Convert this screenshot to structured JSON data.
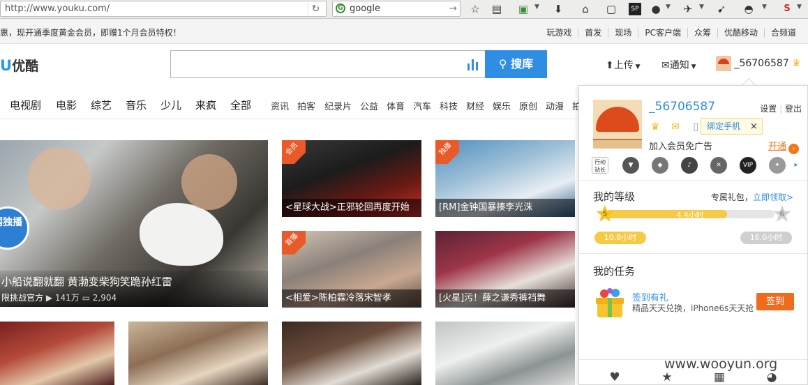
{
  "browser": {
    "url": "http://www.youku.com/",
    "search_engine_text": "google",
    "reload_glyph": "↻",
    "go_glyph": "→",
    "icons": [
      "star-icon",
      "reading-list-icon",
      "addon-icon",
      "download-icon",
      "home-icon",
      "pocket-icon",
      "sp-icon",
      "ghost-icon",
      "bird-icon",
      "cursor-icon",
      "hat-icon",
      "s-shield-icon"
    ]
  },
  "promo": {
    "text": "惠，现开通季度黄金会员，即赠1个月会员特权！",
    "links": [
      "玩游戏",
      "首发",
      "现场",
      "PC客户端",
      "众筹",
      "优酷移动",
      "合频道"
    ]
  },
  "header": {
    "logo_letter": "U",
    "logo_cn": "优酷",
    "search_placeholder": "",
    "search_button": "搜库",
    "upload_label": "上传",
    "notify_label": "通知",
    "username": "_56706587"
  },
  "nav": {
    "main": [
      "电视剧",
      "电影",
      "综艺",
      "音乐",
      "少儿",
      "来疯",
      "全部"
    ],
    "sub": [
      "资讯",
      "拍客",
      "纪录片",
      "公益",
      "体育",
      "汽车",
      "科技",
      "财经",
      "娱乐",
      "原创",
      "动漫",
      "拍"
    ]
  },
  "feature": {
    "tag": "网独播",
    "title": "小船说翻就翻 黄渤变柴狗笑跪孙红雷",
    "channel": "限挑战官方",
    "views": "141万",
    "comments": "2,904"
  },
  "tiles": [
    {
      "caption": "<星球大战>正邪轮回再度开始",
      "badge": "会员"
    },
    {
      "caption": "[RM]金钟国暴揍李光洙",
      "badge": "独播"
    },
    {
      "caption": "<相爱>陈柏霖冷落宋智孝",
      "badge": "首播"
    },
    {
      "caption": "[火星]污！薛之谦秀裤裆舞",
      "badge": ""
    },
    {
      "caption": "",
      "badge": ""
    },
    {
      "caption": "",
      "badge": ""
    },
    {
      "caption": "",
      "badge": ""
    },
    {
      "caption": "",
      "badge": ""
    }
  ],
  "panel": {
    "username": "_56706587",
    "settings": "设置",
    "logout": "登出",
    "bind_phone": "绑定手机",
    "bind_close": "×",
    "vip_text": "加入会员免广告",
    "open_vip": "开通",
    "level_title": "我的等级",
    "gift_prefix": "专属礼包，",
    "gift_link": "立即领取>",
    "level_current": "5",
    "level_next": "6",
    "level_progress_text": "4.4小时",
    "level_progress_fraction": 0.72,
    "hours_current": "10.8小时",
    "hours_next": "16.0小时",
    "task_title": "我的任务",
    "task_name": "签到有礼",
    "task_desc": "精品天天兑换，iPhone6s天天抢",
    "task_button": "签到",
    "icon_labels": [
      "行动站长",
      "狼头",
      "狐狸",
      "音乐",
      "X",
      "VIP",
      "徽章"
    ]
  },
  "watermark": "www.wooyun.org",
  "colors": {
    "accent_blue": "#2f8de4",
    "orange": "#f06c1d",
    "gold": "#f7ca45"
  }
}
